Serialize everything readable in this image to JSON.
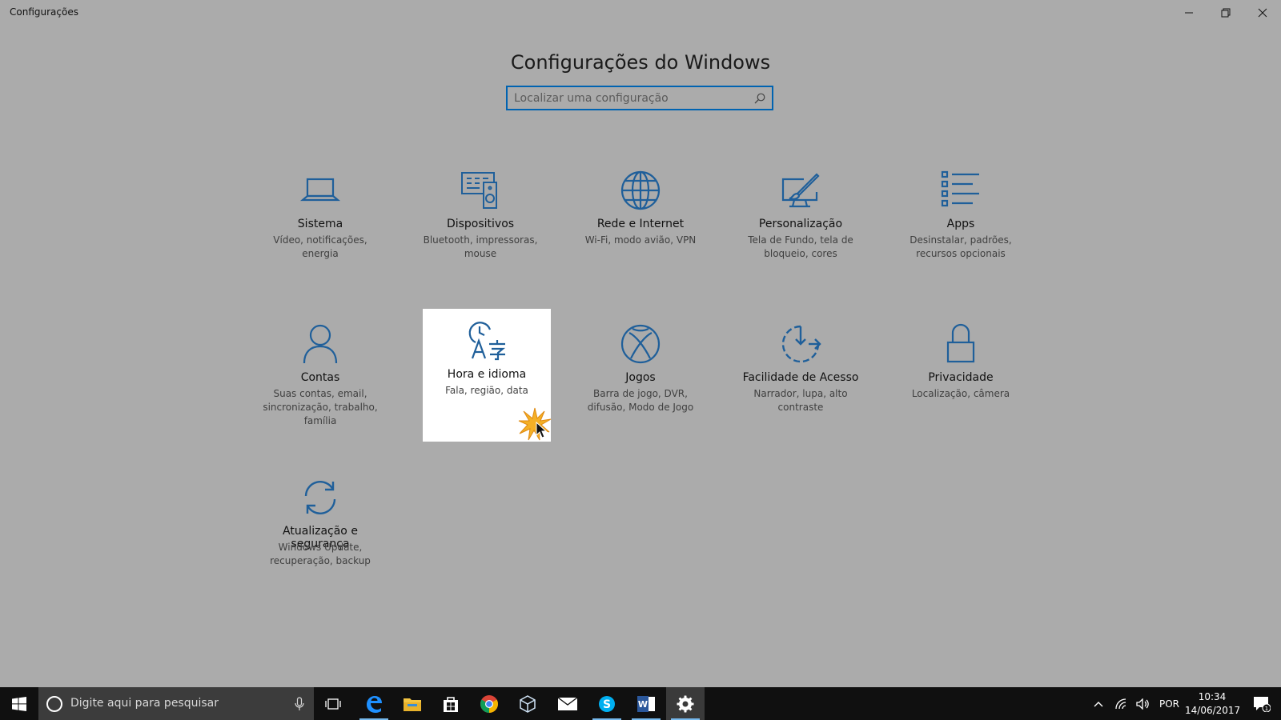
{
  "window": {
    "title": "Configurações"
  },
  "header": {
    "title": "Configurações do Windows"
  },
  "search": {
    "placeholder": "Localizar uma configuração"
  },
  "tiles": [
    {
      "name": "Sistema",
      "desc": "Vídeo, notificações, energia",
      "icon": "laptop-icon"
    },
    {
      "name": "Dispositivos",
      "desc": "Bluetooth, impressoras, mouse",
      "icon": "devices-icon"
    },
    {
      "name": "Rede e Internet",
      "desc": "Wi-Fi, modo avião, VPN",
      "icon": "globe-icon"
    },
    {
      "name": "Personalização",
      "desc": "Tela de Fundo, tela de bloqueio, cores",
      "icon": "personalization-icon"
    },
    {
      "name": "Apps",
      "desc": "Desinstalar, padrões, recursos opcionais",
      "icon": "apps-list-icon"
    },
    {
      "name": "Contas",
      "desc": "Suas contas, email, sincronização, trabalho, família",
      "icon": "person-icon"
    },
    {
      "name": "Hora e idioma",
      "desc": "Fala, região, data",
      "icon": "time-language-icon"
    },
    {
      "name": "Jogos",
      "desc": "Barra de jogo, DVR, difusão, Modo de Jogo",
      "icon": "xbox-icon"
    },
    {
      "name": "Facilidade de Acesso",
      "desc": "Narrador, lupa, alto contraste",
      "icon": "ease-of-access-icon"
    },
    {
      "name": "Privacidade",
      "desc": "Localização, câmera",
      "icon": "lock-icon"
    },
    {
      "name": "Atualização e segurança",
      "desc": "Windows Update, recuperação, backup",
      "icon": "update-sync-icon"
    }
  ],
  "taskbar": {
    "search_placeholder": "Digite aqui para pesquisar",
    "language": "POR",
    "time": "10:34",
    "date": "14/06/2017",
    "notification_count": "1",
    "apps": [
      "start-icon",
      "task-view-icon",
      "edge-icon",
      "file-explorer-icon",
      "store-icon",
      "chrome-icon",
      "virtualbox-icon",
      "mail-icon",
      "skype-icon",
      "word-icon",
      "settings-gear-icon"
    ]
  },
  "colors": {
    "accent": "#0063b1",
    "icon": "#1f5f9a",
    "background": "#ababab",
    "taskbar": "#101010",
    "hover_tile": "#ffffff"
  }
}
